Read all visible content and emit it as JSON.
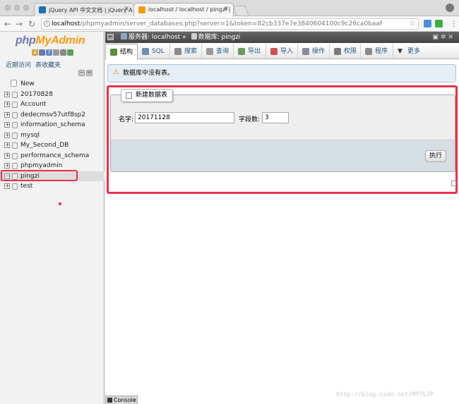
{
  "browser": {
    "tabs": [
      {
        "title": "jQuery API 中文文档 | jQuery A"
      },
      {
        "title": "localhost / localhost / pingzi | "
      }
    ],
    "url_host": "localhost",
    "url_path": "/phpmyadmin/server_databases.php?server=1&token=82cb337e7e3840604100c9c26ca0baaf"
  },
  "sidebar": {
    "logo": {
      "php": "php",
      "my": "My",
      "admin": "Admin"
    },
    "links": [
      "近期访问",
      "表收藏夹"
    ],
    "items": [
      {
        "label": "New"
      },
      {
        "label": "20170828"
      },
      {
        "label": "Account"
      },
      {
        "label": "dedecmsv57utf8sp2"
      },
      {
        "label": "information_schema"
      },
      {
        "label": "mysql"
      },
      {
        "label": "My_Second_DB"
      },
      {
        "label": "performance_schema"
      },
      {
        "label": "phpmyadmin"
      },
      {
        "label": "pingzi"
      },
      {
        "label": "test"
      }
    ],
    "selected": "pingzi"
  },
  "breadcrumb": {
    "server_label": "服务器: localhost",
    "separator": "»",
    "db_label": "数据库: pingzi"
  },
  "tabs": [
    {
      "label": "结构",
      "icon": "structure-icon",
      "color": "#5a8f3a"
    },
    {
      "label": "SQL",
      "icon": "sql-icon",
      "color": "#6d8fb3"
    },
    {
      "label": "搜索",
      "icon": "search-icon",
      "color": "#8a8a8a"
    },
    {
      "label": "查询",
      "icon": "query-icon",
      "color": "#9a9a9a"
    },
    {
      "label": "导出",
      "icon": "export-icon",
      "color": "#6a9a5a"
    },
    {
      "label": "导入",
      "icon": "import-icon",
      "color": "#d05050"
    },
    {
      "label": "操作",
      "icon": "wrench-icon",
      "color": "#8a8aa0"
    },
    {
      "label": "权限",
      "icon": "privileges-icon",
      "color": "#7a7a7a"
    },
    {
      "label": "程序",
      "icon": "routines-icon",
      "color": "#8a8a8a"
    },
    {
      "label": "更多",
      "icon": "chevron-down-icon",
      "color": "#333333"
    }
  ],
  "notice": {
    "text": "数据库中没有表。"
  },
  "create_table": {
    "legend": "新建数据表",
    "name_label": "名字:",
    "name_value": "20171128",
    "fields_label": "字段数:",
    "fields_value": "3",
    "go_label": "执行"
  },
  "console": {
    "label": "Console"
  },
  "watermark": "http://blog.csdn.net/MYTLJP",
  "colors": {
    "highlight": "#e8304a",
    "link": "#235a81"
  }
}
